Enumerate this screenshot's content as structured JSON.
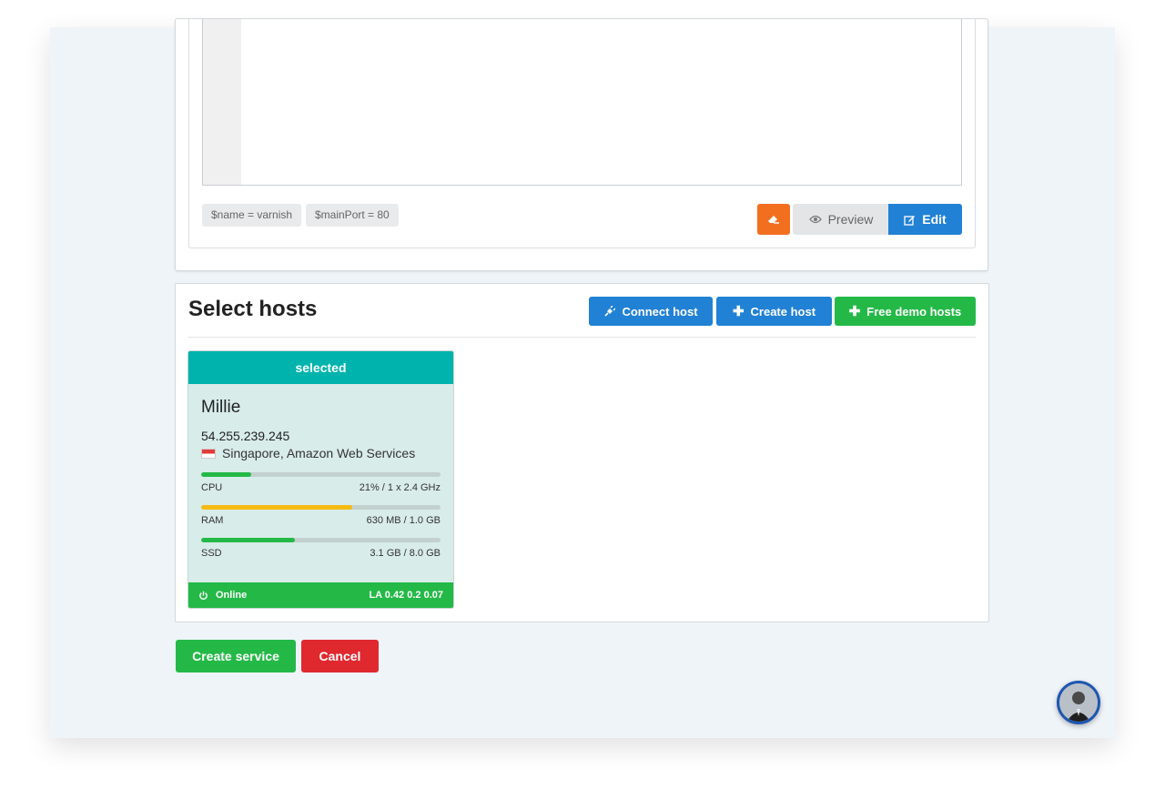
{
  "editor": {
    "vars": [
      "$name = varnish",
      "$mainPort = 80"
    ],
    "preview_label": "Preview",
    "edit_label": "Edit"
  },
  "hosts": {
    "title": "Select hosts",
    "connect_label": "Connect host",
    "create_label": "Create host",
    "demo_label": "Free demo hosts",
    "card": {
      "badge": "selected",
      "name": "Millie",
      "ip": "54.255.239.245",
      "location": "Singapore, Amazon Web Services",
      "cpu": {
        "label": "CPU",
        "value": "21% / 1 x 2.4 GHz",
        "fraction": 0.21
      },
      "ram": {
        "label": "RAM",
        "value": "630 MB / 1.0 GB",
        "fraction": 0.63
      },
      "ssd": {
        "label": "SSD",
        "value": "3.1 GB / 8.0 GB",
        "fraction": 0.39
      },
      "status": "Online",
      "load": "LA 0.42 0.2 0.07"
    }
  },
  "actions": {
    "create_service": "Create service",
    "cancel": "Cancel"
  },
  "colors": {
    "primary": "#2181d4",
    "success": "#24b947",
    "danger": "#e0282f",
    "warning": "#f36f20",
    "teal": "#00b3ad",
    "ram_bar": "#f5bb12"
  }
}
